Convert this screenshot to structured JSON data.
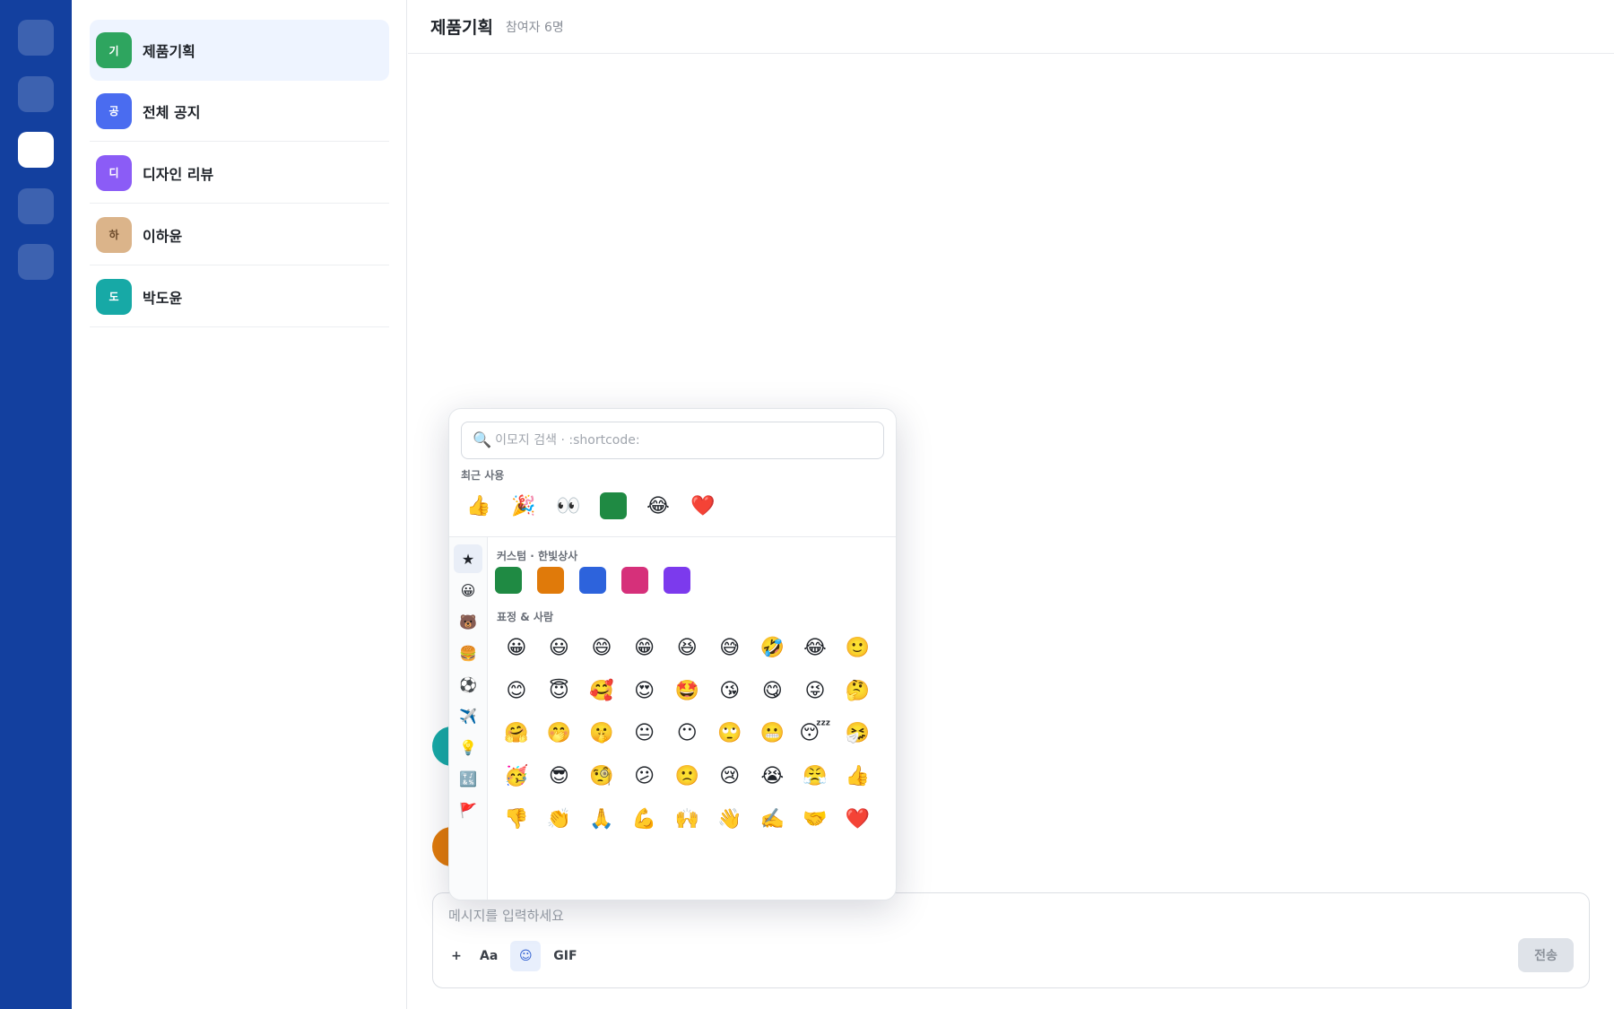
{
  "rail": {
    "items": [
      "",
      "",
      "",
      "",
      ""
    ],
    "active_index": 2
  },
  "channels": [
    {
      "name": "제품기획",
      "initial": "기",
      "color": "#2ea55f",
      "active": true
    },
    {
      "name": "전체 공지",
      "initial": "공",
      "color": "#4a6cf0",
      "active": false
    },
    {
      "name": "디자인 리뷰",
      "initial": "디",
      "color": "#8b5cf6",
      "active": false
    },
    {
      "name": "이하윤",
      "initial": "하",
      "color": "#dbb48a",
      "text_color": "#6b4a2a",
      "active": false
    },
    {
      "name": "박도윤",
      "initial": "도",
      "color": "#17a9a6",
      "active": false
    }
  ],
  "header": {
    "title": "제품기획",
    "subtitle": "참여자 6명"
  },
  "composer": {
    "placeholder": "메시지를 입력하세요",
    "tools": {
      "plus": "+",
      "format": "Aa",
      "emoji": "☺",
      "gif": "GIF"
    },
    "send_label": "전송"
  },
  "picker": {
    "search_placeholder": "이모지 검색 · :shortcode:",
    "search_icon": "🔍",
    "recent_label": "최근 사용",
    "recent": [
      "👍",
      "🎉",
      "👀",
      "",
      "😂",
      "❤️"
    ],
    "recent_custom_color": "#1f8a43",
    "custom_label": "커스텀 · 한빛상사",
    "custom_colors": [
      "#1f8a43",
      "#e07a0a",
      "#2d63dc",
      "#d6307a",
      "#7c3aed"
    ],
    "people_label": "표정 & 사람",
    "categories": [
      "★",
      "😀",
      "🐻",
      "🍔",
      "⚽",
      "✈️",
      "💡",
      "🔣",
      "🚩"
    ],
    "emojis": [
      "😀",
      "😃",
      "😄",
      "😁",
      "😆",
      "😅",
      "🤣",
      "😂",
      "🙂",
      "😊",
      "😇",
      "🥰",
      "😍",
      "🤩",
      "😘",
      "😋",
      "😜",
      "🤔",
      "🤗",
      "🤭",
      "🤫",
      "😐",
      "😶",
      "🙄",
      "😬",
      "😴",
      "🤧",
      "🥳",
      "😎",
      "🧐",
      "😕",
      "🙁",
      "😢",
      "😭",
      "😤",
      "👍",
      "👎",
      "👏",
      "🙏",
      "💪",
      "🙌",
      "👋",
      "✍️",
      "🤝",
      "❤️"
    ]
  },
  "bubbles": [
    {
      "color": "#17a9a6"
    },
    {
      "color": "#e07a0a"
    }
  ]
}
